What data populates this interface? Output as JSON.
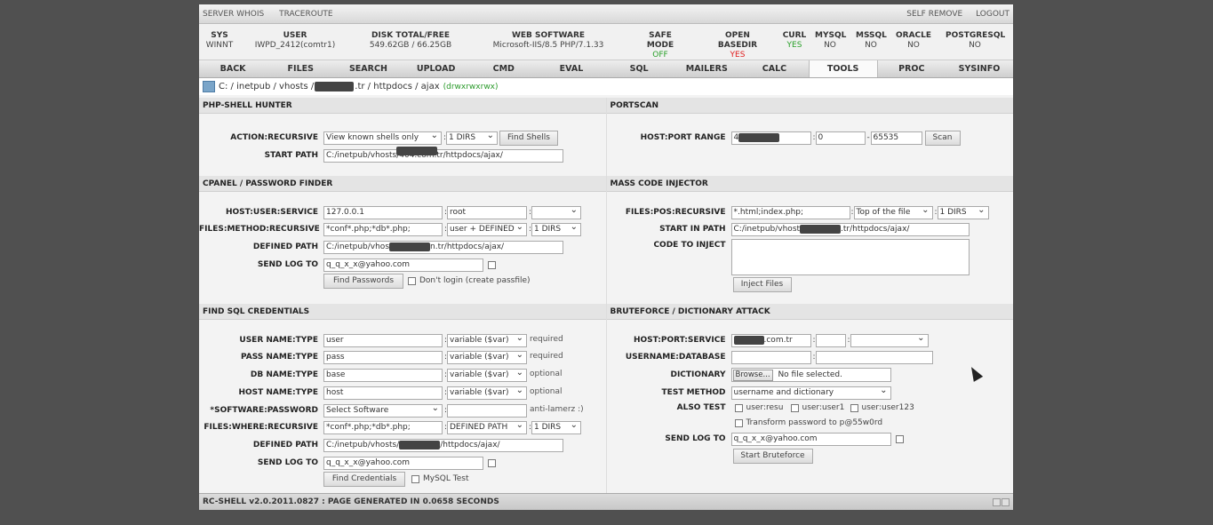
{
  "topbar": {
    "left": [
      "SERVER WHOIS",
      "TRACEROUTE"
    ],
    "right": [
      "SELF REMOVE",
      "LOGOUT"
    ]
  },
  "info": {
    "sys": {
      "label": "SYS",
      "value": "WINNT"
    },
    "user": {
      "label": "USER",
      "value": "IWPD_2412(comtr1)"
    },
    "disk": {
      "label": "DISK TOTAL/FREE",
      "value": "549.62GB / 66.25GB"
    },
    "web": {
      "label": "WEB SOFTWARE",
      "value": "Microsoft-IIS/8.5 PHP/7.1.33"
    },
    "safe": {
      "label": "SAFE MODE",
      "value": "OFF"
    },
    "basedir": {
      "label": "OPEN BASEDIR",
      "value": "YES"
    },
    "curl": {
      "label": "CURL",
      "value": "YES"
    },
    "mysql": {
      "label": "MYSQL",
      "value": "NO"
    },
    "mssql": {
      "label": "MSSQL",
      "value": "NO"
    },
    "oracle": {
      "label": "ORACLE",
      "value": "NO"
    },
    "postgresql": {
      "label": "POSTGRESQL",
      "value": "NO"
    }
  },
  "menu": [
    "BACK",
    "FILES",
    "SEARCH",
    "UPLOAD",
    "CMD",
    "EVAL",
    "SQL",
    "MAILERS",
    "CALC",
    "TOOLS",
    "PROC",
    "SYSINFO"
  ],
  "path": {
    "prefix": "C: / inetpub / vhosts /",
    "suffix": ".tr / httpdocs / ajax",
    "perm": "(drwxrwxrwx)"
  },
  "shell_hunter": {
    "title": "PHP-SHELL HUNTER",
    "action_label": "ACTION:RECURSIVE",
    "action_value": "View known shells only",
    "dirs_value": "1 DIRS",
    "find_button": "Find Shells",
    "start_label": "START PATH",
    "start_value": "C:/inetpub/vhosts/404.com.tr/httpdocs/ajax/"
  },
  "portscan": {
    "title": "PORTSCAN",
    "label": "HOST:PORT RANGE",
    "host_prefix": "4",
    "port_from": "0",
    "port_to": "65535",
    "button": "Scan"
  },
  "cpanel": {
    "title": "CPANEL / PASSWORD FINDER",
    "hus_label": "HOST:USER:SERVICE",
    "host": "127.0.0.1",
    "user": "root",
    "fmr_label": "FILES:METHOD:RECURSIVE",
    "files": "*conf*.php;*db*.php;",
    "method": "user + DEFINED",
    "dirs": "1 DIRS",
    "defined_label": "DEFINED PATH",
    "defined_prefix": "C:/inetpub/vhos",
    "defined_suffix": "n.tr/httpdocs/ajax/",
    "sendlog_label": "SEND LOG TO",
    "sendlog": "q_q_x_x@yahoo.com",
    "button": "Find Passwords",
    "dont_login": "Don't login (create passfile)"
  },
  "injector": {
    "title": "MASS CODE INJECTOR",
    "fpr_label": "FILES:POS:RECURSIVE",
    "files": "*.html;index.php;",
    "pos": "Top of the file",
    "dirs": "1 DIRS",
    "start_label": "START IN PATH",
    "start_prefix": "C:/inetpub/vhost",
    "start_suffix": ".tr/httpdocs/ajax/",
    "code_label": "CODE TO INJECT",
    "button": "Inject Files"
  },
  "sql": {
    "title": "FIND SQL CREDENTIALS",
    "rows": [
      {
        "label": "USER NAME:TYPE",
        "value": "user",
        "type": "variable ($var)",
        "note": "required"
      },
      {
        "label": "PASS NAME:TYPE",
        "value": "pass",
        "type": "variable ($var)",
        "note": "required"
      },
      {
        "label": "DB NAME:TYPE",
        "value": "base",
        "type": "variable ($var)",
        "note": "optional"
      },
      {
        "label": "HOST NAME:TYPE",
        "value": "host",
        "type": "variable ($var)",
        "note": "optional"
      }
    ],
    "software_label": "*SOFTWARE:PASSWORD",
    "software": "Select Software",
    "software_note": "anti-lamerz :)",
    "fwr_label": "FILES:WHERE:RECURSIVE",
    "files": "*conf*.php;*db*.php;",
    "where": "DEFINED PATH",
    "dirs": "1 DIRS",
    "defined_label": "DEFINED PATH",
    "defined_prefix": "C:/inetpub/vhosts/",
    "defined_suffix": "/httpdocs/ajax/",
    "sendlog_label": "SEND LOG TO",
    "sendlog": "q_q_x_x@yahoo.com",
    "button": "Find Credentials",
    "mysql_test": "MySQL Test"
  },
  "brute": {
    "title": "BRUTEFORCE / DICTIONARY ATTACK",
    "hps_label": "HOST:PORT:SERVICE",
    "host_suffix": ".com.tr",
    "ud_label": "USERNAME:DATABASE",
    "dict_label": "DICTIONARY",
    "browse": "Browse...",
    "no_file": "No file selected.",
    "method_label": "TEST METHOD",
    "method": "username and dictionary",
    "also_label": "ALSO TEST",
    "also": [
      "user:resu",
      "user:user1",
      "user:user123"
    ],
    "transform": "Transform password to p@55w0rd",
    "sendlog_label": "SEND LOG TO",
    "sendlog": "q_q_x_x@yahoo.com",
    "button": "Start Bruteforce"
  },
  "footer": "RC-SHELL v2.0.2011.0827 : PAGE GENERATED IN 0.0658 SECONDS"
}
